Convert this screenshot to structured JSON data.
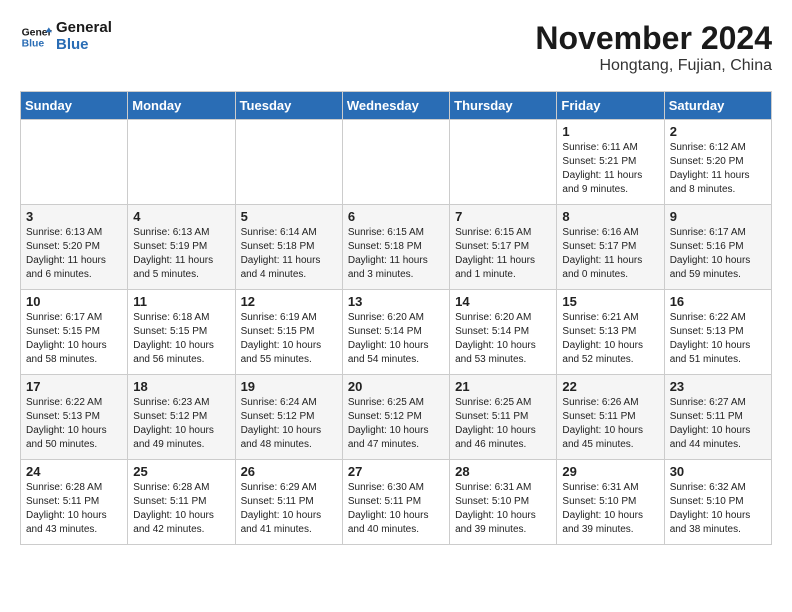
{
  "header": {
    "logo_line1": "General",
    "logo_line2": "Blue",
    "month": "November 2024",
    "location": "Hongtang, Fujian, China"
  },
  "days_of_week": [
    "Sunday",
    "Monday",
    "Tuesday",
    "Wednesday",
    "Thursday",
    "Friday",
    "Saturday"
  ],
  "weeks": [
    [
      {
        "day": "",
        "content": ""
      },
      {
        "day": "",
        "content": ""
      },
      {
        "day": "",
        "content": ""
      },
      {
        "day": "",
        "content": ""
      },
      {
        "day": "",
        "content": ""
      },
      {
        "day": "1",
        "content": "Sunrise: 6:11 AM\nSunset: 5:21 PM\nDaylight: 11 hours and 9 minutes."
      },
      {
        "day": "2",
        "content": "Sunrise: 6:12 AM\nSunset: 5:20 PM\nDaylight: 11 hours and 8 minutes."
      }
    ],
    [
      {
        "day": "3",
        "content": "Sunrise: 6:13 AM\nSunset: 5:20 PM\nDaylight: 11 hours and 6 minutes."
      },
      {
        "day": "4",
        "content": "Sunrise: 6:13 AM\nSunset: 5:19 PM\nDaylight: 11 hours and 5 minutes."
      },
      {
        "day": "5",
        "content": "Sunrise: 6:14 AM\nSunset: 5:18 PM\nDaylight: 11 hours and 4 minutes."
      },
      {
        "day": "6",
        "content": "Sunrise: 6:15 AM\nSunset: 5:18 PM\nDaylight: 11 hours and 3 minutes."
      },
      {
        "day": "7",
        "content": "Sunrise: 6:15 AM\nSunset: 5:17 PM\nDaylight: 11 hours and 1 minute."
      },
      {
        "day": "8",
        "content": "Sunrise: 6:16 AM\nSunset: 5:17 PM\nDaylight: 11 hours and 0 minutes."
      },
      {
        "day": "9",
        "content": "Sunrise: 6:17 AM\nSunset: 5:16 PM\nDaylight: 10 hours and 59 minutes."
      }
    ],
    [
      {
        "day": "10",
        "content": "Sunrise: 6:17 AM\nSunset: 5:15 PM\nDaylight: 10 hours and 58 minutes."
      },
      {
        "day": "11",
        "content": "Sunrise: 6:18 AM\nSunset: 5:15 PM\nDaylight: 10 hours and 56 minutes."
      },
      {
        "day": "12",
        "content": "Sunrise: 6:19 AM\nSunset: 5:15 PM\nDaylight: 10 hours and 55 minutes."
      },
      {
        "day": "13",
        "content": "Sunrise: 6:20 AM\nSunset: 5:14 PM\nDaylight: 10 hours and 54 minutes."
      },
      {
        "day": "14",
        "content": "Sunrise: 6:20 AM\nSunset: 5:14 PM\nDaylight: 10 hours and 53 minutes."
      },
      {
        "day": "15",
        "content": "Sunrise: 6:21 AM\nSunset: 5:13 PM\nDaylight: 10 hours and 52 minutes."
      },
      {
        "day": "16",
        "content": "Sunrise: 6:22 AM\nSunset: 5:13 PM\nDaylight: 10 hours and 51 minutes."
      }
    ],
    [
      {
        "day": "17",
        "content": "Sunrise: 6:22 AM\nSunset: 5:13 PM\nDaylight: 10 hours and 50 minutes."
      },
      {
        "day": "18",
        "content": "Sunrise: 6:23 AM\nSunset: 5:12 PM\nDaylight: 10 hours and 49 minutes."
      },
      {
        "day": "19",
        "content": "Sunrise: 6:24 AM\nSunset: 5:12 PM\nDaylight: 10 hours and 48 minutes."
      },
      {
        "day": "20",
        "content": "Sunrise: 6:25 AM\nSunset: 5:12 PM\nDaylight: 10 hours and 47 minutes."
      },
      {
        "day": "21",
        "content": "Sunrise: 6:25 AM\nSunset: 5:11 PM\nDaylight: 10 hours and 46 minutes."
      },
      {
        "day": "22",
        "content": "Sunrise: 6:26 AM\nSunset: 5:11 PM\nDaylight: 10 hours and 45 minutes."
      },
      {
        "day": "23",
        "content": "Sunrise: 6:27 AM\nSunset: 5:11 PM\nDaylight: 10 hours and 44 minutes."
      }
    ],
    [
      {
        "day": "24",
        "content": "Sunrise: 6:28 AM\nSunset: 5:11 PM\nDaylight: 10 hours and 43 minutes."
      },
      {
        "day": "25",
        "content": "Sunrise: 6:28 AM\nSunset: 5:11 PM\nDaylight: 10 hours and 42 minutes."
      },
      {
        "day": "26",
        "content": "Sunrise: 6:29 AM\nSunset: 5:11 PM\nDaylight: 10 hours and 41 minutes."
      },
      {
        "day": "27",
        "content": "Sunrise: 6:30 AM\nSunset: 5:11 PM\nDaylight: 10 hours and 40 minutes."
      },
      {
        "day": "28",
        "content": "Sunrise: 6:31 AM\nSunset: 5:10 PM\nDaylight: 10 hours and 39 minutes."
      },
      {
        "day": "29",
        "content": "Sunrise: 6:31 AM\nSunset: 5:10 PM\nDaylight: 10 hours and 39 minutes."
      },
      {
        "day": "30",
        "content": "Sunrise: 6:32 AM\nSunset: 5:10 PM\nDaylight: 10 hours and 38 minutes."
      }
    ]
  ]
}
